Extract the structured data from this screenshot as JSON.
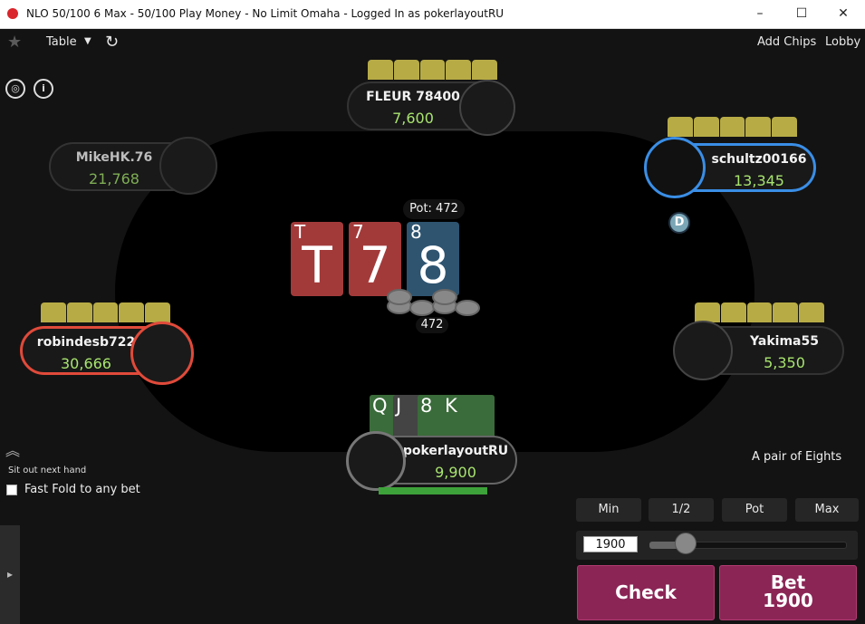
{
  "window": {
    "title": "NLO 50/100 6 Max - 50/100 Play Money - No Limit Omaha - Logged In as pokerlayoutRU",
    "minimize_icon": "minimize-icon",
    "maximize_icon": "maximize-icon",
    "close_icon": "close-icon"
  },
  "toolbar": {
    "table_label": "Table",
    "add_chips": "Add Chips",
    "lobby": "Lobby"
  },
  "seats": [
    {
      "name": "FLEUR 78400",
      "stack": "7,600"
    },
    {
      "name": "MikeHK.76",
      "stack": "21,768"
    },
    {
      "name": "schultz00166",
      "stack": "13,345"
    },
    {
      "name": "robindesb722",
      "stack": "30,666"
    },
    {
      "name": "Yakima55",
      "stack": "5,350"
    },
    {
      "name": "pokerlayoutRU",
      "stack": "9,900"
    }
  ],
  "pot": {
    "label": "Pot: 472",
    "chips_amount": "472"
  },
  "board": [
    {
      "rank": "T",
      "color": "#a33a3a"
    },
    {
      "rank": "7",
      "color": "#a33a3a"
    },
    {
      "rank": "8",
      "color": "#2e5470"
    }
  ],
  "hero_cards": [
    {
      "rank": "Q",
      "color": "#3a6b3a"
    },
    {
      "rank": "J",
      "color": "#444444"
    },
    {
      "rank": "8",
      "color": "#3a6b3a"
    },
    {
      "rank": "K",
      "color": "#3a6b3a"
    }
  ],
  "dealer_button": "D",
  "hand_rank": "A pair of Eights",
  "left_panel": {
    "sit_out": "Sit out next hand",
    "fast_fold": "Fast Fold to any bet"
  },
  "bet_controls": {
    "presets": [
      "Min",
      "1/2",
      "Pot",
      "Max"
    ],
    "bet_value": "1900",
    "check_label": "Check",
    "bet_label_line1": "Bet",
    "bet_label_line2": "1900"
  },
  "colors": {
    "action_button": "#8b2556",
    "stack_text": "#a8e46f",
    "active_seat": "#3a8ee6",
    "alert_seat": "#e04a3a"
  }
}
